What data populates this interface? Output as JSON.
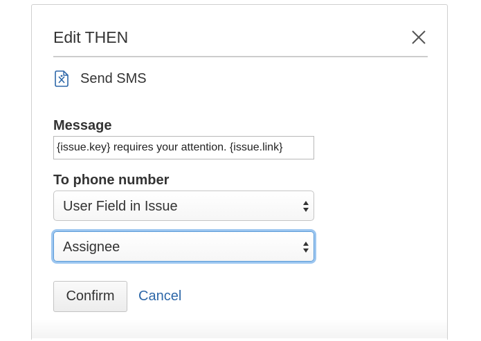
{
  "dialog": {
    "title": "Edit THEN",
    "close_icon": "close-icon"
  },
  "action": {
    "icon": "sms-icon",
    "label": "Send SMS"
  },
  "message": {
    "label": "Message",
    "value": "{issue.key} requires your attention. {issue.link}"
  },
  "phone": {
    "label": "To phone number",
    "source_select": "User Field in Issue",
    "field_select": "Assignee"
  },
  "buttons": {
    "confirm": "Confirm",
    "cancel": "Cancel"
  },
  "colors": {
    "link": "#2d67a8",
    "focus_ring": "#9cc6f0",
    "text": "#333333"
  }
}
